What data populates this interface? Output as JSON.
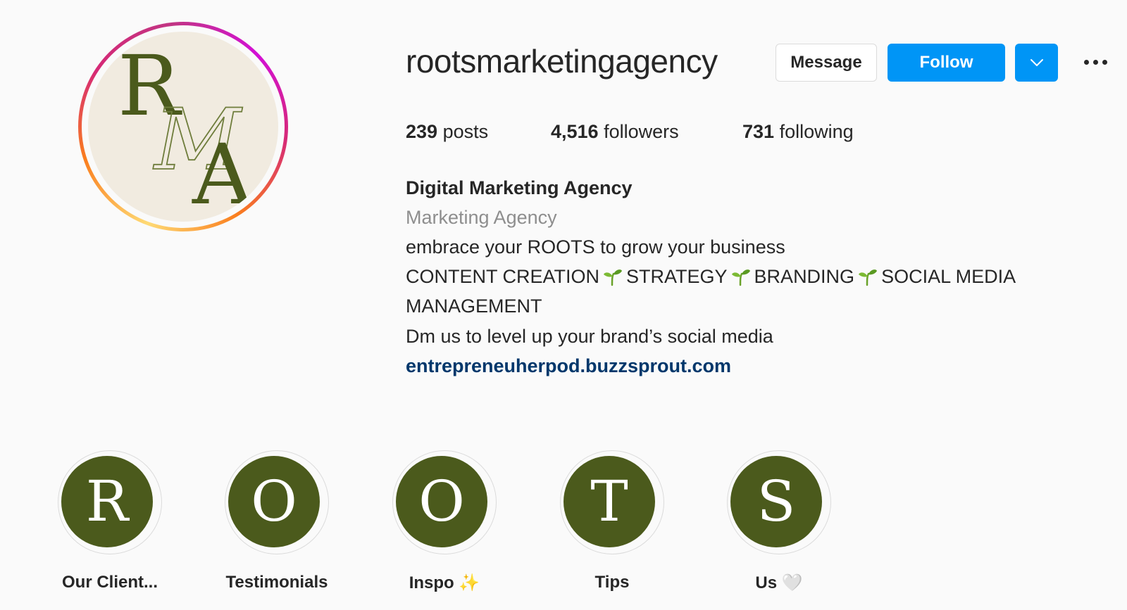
{
  "profile": {
    "username": "rootsmarketingagency",
    "avatar_initials": [
      "R",
      "M",
      "A"
    ],
    "avatar_bg": "#f1ebe0",
    "avatar_letter_color": "#4b5a1c"
  },
  "actions": {
    "message_label": "Message",
    "follow_label": "Follow",
    "dropdown_icon": "chevron-down-icon",
    "more_icon": "more-options-icon",
    "follow_color": "#0095f6"
  },
  "stats": {
    "posts_count": "239",
    "posts_label": " posts",
    "followers_count": "4,516",
    "followers_label": " followers",
    "following_count": "731",
    "following_label": " following"
  },
  "bio": {
    "name": "Digital Marketing Agency",
    "category": "Marketing Agency",
    "tagline": "embrace your ROOTS to grow your business",
    "services": [
      "CONTENT CREATION",
      "STRATEGY",
      "BRANDING",
      "SOCIAL MEDIA"
    ],
    "services_wrap": "MANAGEMENT",
    "services_separator_icon": "seedling-icon",
    "cta": "Dm us to level up your brand’s social media",
    "link": "entrepreneuherpod.buzzsprout.com",
    "link_color": "#00376b"
  },
  "highlights": [
    {
      "letter": "R",
      "label": "Our Client..."
    },
    {
      "letter": "O",
      "label": "Testimonials"
    },
    {
      "letter": "O",
      "label": "Inspo ",
      "emoji": "✨"
    },
    {
      "letter": "T",
      "label": "Tips"
    },
    {
      "letter": "S",
      "label": "Us ",
      "emoji": "🤍"
    }
  ],
  "highlight_color": "#4b5a1c"
}
